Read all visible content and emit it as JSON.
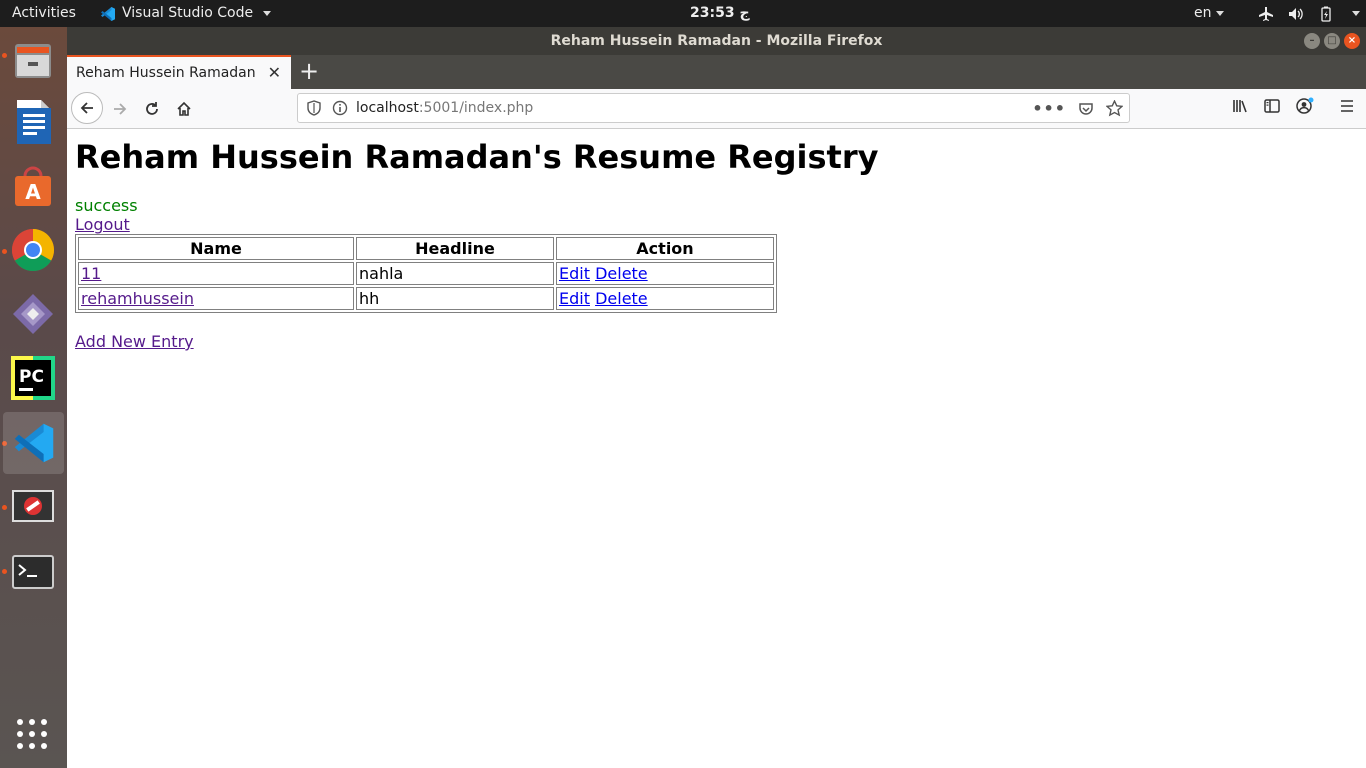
{
  "topbar": {
    "activities": "Activities",
    "app_name": "Visual Studio Code",
    "clock": "23:53 ج",
    "lang": "en"
  },
  "window": {
    "title": "Reham Hussein Ramadan - Mozilla Firefox"
  },
  "tab": {
    "title": "Reham Hussein Ramadan"
  },
  "url": {
    "host": "localhost",
    "rest": ":5001/index.php"
  },
  "page": {
    "heading": "Reham Hussein Ramadan's Resume Registry",
    "flash": "success",
    "logout": "Logout",
    "table": {
      "headers": [
        "Name",
        "Headline",
        "Action"
      ],
      "rows": [
        {
          "name": "11",
          "headline": "nahla",
          "edit": "Edit",
          "delete": "Delete"
        },
        {
          "name": "rehamhussein",
          "headline": "hh",
          "edit": "Edit",
          "delete": "Delete"
        }
      ]
    },
    "add_entry": "Add New Entry"
  },
  "colors": {
    "accent": "#e95420",
    "flash": "#008000",
    "visited_link": "#551a8b",
    "link": "#0000ee"
  }
}
